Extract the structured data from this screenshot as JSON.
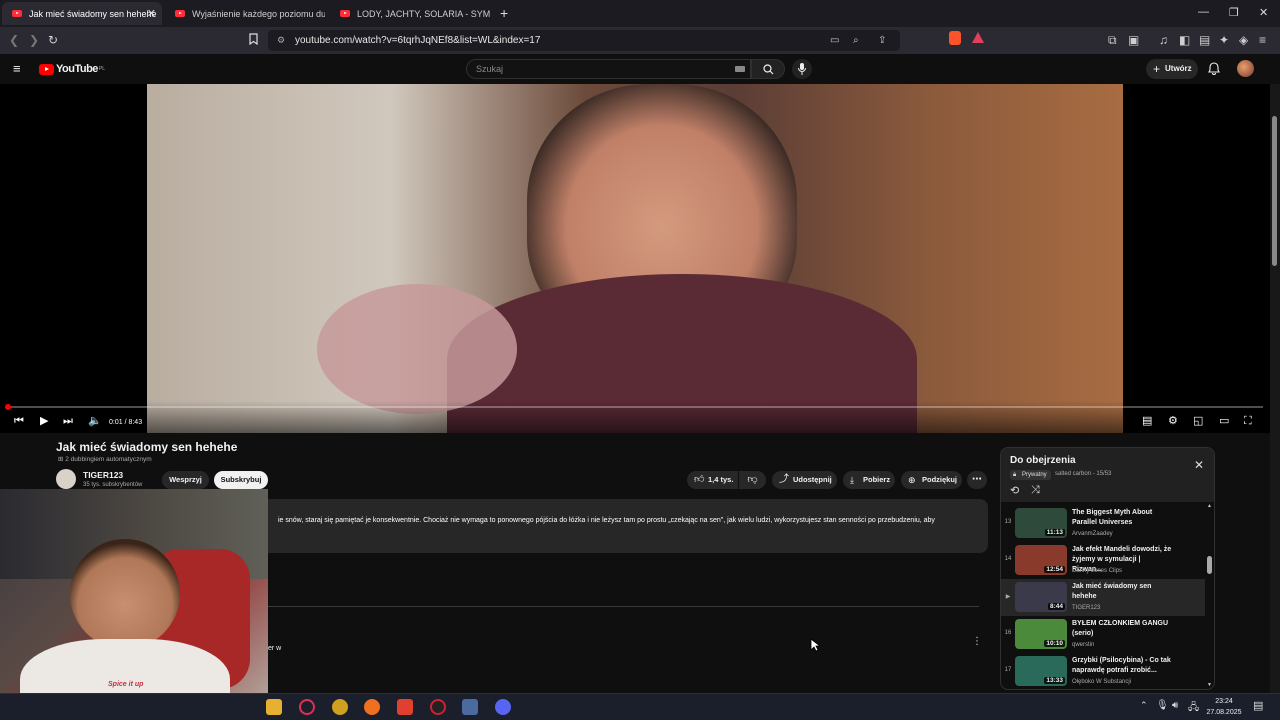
{
  "browser": {
    "tabs": [
      {
        "title": "Jak mieć świadomy sen hehehe",
        "active": true
      },
      {
        "title": "Wyjaśnienie każdego poziomu duch",
        "active": false
      },
      {
        "title": "LODY, JACHTY, SOLARIA - SYMBOLE",
        "active": false
      }
    ],
    "new_tab": "+",
    "url": "youtube.com/watch?v=6tqrhJqNEf8&list=WL&index=17",
    "window_controls": {
      "minimize": "—",
      "maximize": "❐",
      "close": "✕"
    }
  },
  "youtube": {
    "logo_text": "YouTube",
    "logo_region": "PL",
    "search_placeholder": "Szukaj",
    "create_label": "Utwórz"
  },
  "player": {
    "time": "0:01 / 8:43",
    "progress_fraction": 0.002
  },
  "video": {
    "title": "Jak mieć świadomy sen hehehe",
    "dubbing": "2 dubbingiem automatycznym",
    "channel": "TIGER123",
    "subscribers": "35 tys. subskrybentów",
    "support_label": "Wesprzyj",
    "subscribe_label": "Subskrybuj",
    "likes": "1,4 tys.",
    "share_label": "Udostępnij",
    "download_label": "Pobierz",
    "thanks_label": "Podziękuj",
    "description": "ie snów, staraj się pamiętać je konsekwentnie. Chociaż nie wymaga to ponownego pójścia do łóżka i nie leżysz tam po prostu „czekając na sen\", jak wielu ludzi, wykorzystujesz stan senności po przebudzeniu, aby",
    "comment_fragment": "er w"
  },
  "playlist": {
    "title": "Do obejrzenia",
    "privacy": "Prywatny",
    "owner_info": "salted carbon - 15/53",
    "items": [
      {
        "num": "13",
        "title": "The Biggest Myth About Parallel Universes",
        "channel": "ArvanmZaadey",
        "duration": "11:13",
        "current": false,
        "color": "#2e4a3a"
      },
      {
        "num": "14",
        "title": "Jak efekt Mandeli dowodzi, że żyjemy w symulacji | Rizwan...",
        "channel": "Danny Jones Clips",
        "duration": "12:54",
        "current": false,
        "color": "#8a3a2a"
      },
      {
        "num": "▶",
        "title": "Jak mieć świadomy sen hehehe",
        "channel": "TIGER123",
        "duration": "8:44",
        "current": true,
        "color": "#3a3a4a"
      },
      {
        "num": "16",
        "title": "BYŁEM CZŁONKIEM GANGU (serio)",
        "channel": "qwerstin",
        "duration": "10:10",
        "current": false,
        "color": "#4a8a3a"
      },
      {
        "num": "17",
        "title": "Grzybki (Psilocybina) - Co tak naprawdę potrafi zrobić...",
        "channel": "Ołęboko W Substancji",
        "duration": "13:33",
        "current": false,
        "color": "#2a6a5a"
      }
    ]
  },
  "webcam": {
    "shirt_text": "Spice it up"
  },
  "taskbar": {
    "time": "23:24",
    "date": "27.08.2025"
  }
}
